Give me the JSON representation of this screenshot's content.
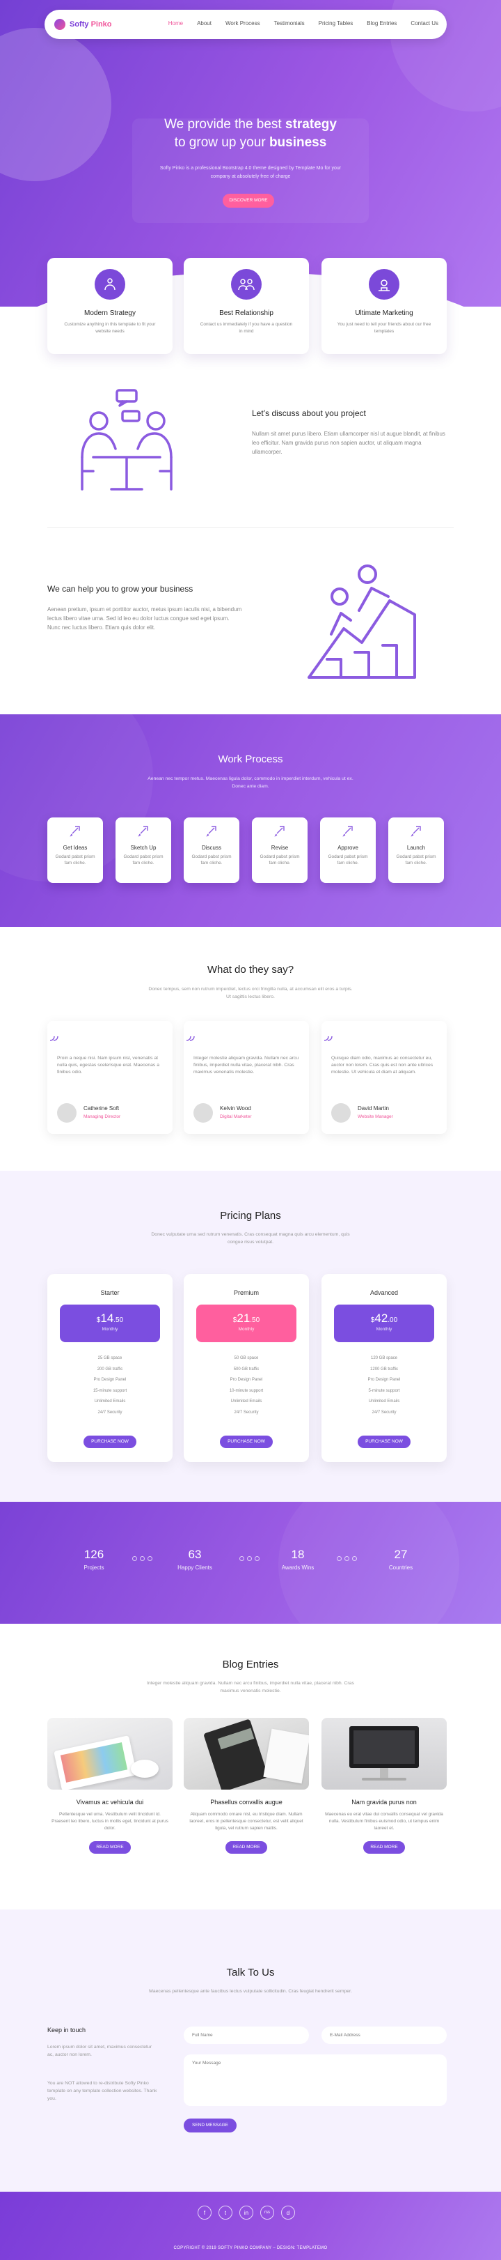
{
  "brand": {
    "name_main": "Softy",
    "name_accent": "Pinko"
  },
  "nav": {
    "items": [
      "Home",
      "About",
      "Work Process",
      "Testimonials",
      "Pricing Tables",
      "Blog Entries",
      "Contact Us"
    ]
  },
  "hero": {
    "title_pre": "We provide the best ",
    "title_b1": "strategy",
    "title_mid": "to grow up your ",
    "title_b2": "business",
    "subtitle": "Softy Pinko is a professional Bootstrap 4.0 theme designed by Template Mo for your company at absolutely free of charge",
    "cta": "DISCOVER MORE"
  },
  "features": [
    {
      "title": "Modern Strategy",
      "text": "Customize anything in this template to fit your website needs",
      "icon": "strategy-icon"
    },
    {
      "title": "Best Relationship",
      "text": "Contact us immediately if you have a question in mind",
      "icon": "relationship-icon"
    },
    {
      "title": "Ultimate Marketing",
      "text": "You just need to tell your friends about our free templates",
      "icon": "marketing-icon"
    }
  ],
  "about1": {
    "title": "Let’s discuss about you project",
    "text": "Nullam sit amet purus libero. Etiam ullamcorper nisl ut augue blandit, at finibus leo efficitur. Nam gravida purus non sapien auctor, ut aliquam magna ullamcorper."
  },
  "about2": {
    "title": "We can help you to grow your business",
    "text": "Aenean pretium, ipsum et porttitor auctor, metus ipsum iaculis nisi, a bibendum lectus libero vitae urna. Sed id leo eu dolor luctus congue sed eget ipsum. Nunc nec luctus libero. Etiam quis dolor elit."
  },
  "work": {
    "title": "Work Process",
    "subtitle": "Aenean nec tempor metus. Maecenas ligula dolor, commodo in imperdiet interdum, vehicula ut ex. Donec ante diam.",
    "steps": [
      {
        "title": "Get Ideas",
        "text": "Godard pabst prism fam cliche."
      },
      {
        "title": "Sketch Up",
        "text": "Godard pabst prism fam cliche."
      },
      {
        "title": "Discuss",
        "text": "Godard pabst prism fam cliche."
      },
      {
        "title": "Revise",
        "text": "Godard pabst prism fam cliche."
      },
      {
        "title": "Approve",
        "text": "Godard pabst prism fam cliche."
      },
      {
        "title": "Launch",
        "text": "Godard pabst prism fam cliche."
      }
    ]
  },
  "testimonials": {
    "title": "What do they say?",
    "subtitle": "Donec tempus, sem non rutrum imperdiet, lectus orci fringilla nulla, at accumsan elit eros a turpis. Ut sagittis lectus libero.",
    "items": [
      {
        "text": "Proin a neque nisi. Nam ipsum nisl, venenatis at nulla quis, egestas scelerisque erat. Maecenas a finibus odio.",
        "name": "Catherine Soft",
        "role": "Managing Director"
      },
      {
        "text": "Integer molestie aliquam gravida. Nullam nec arcu finibus, imperdiet nulla vitae, placerat nibh. Cras maximus venenatis molestie.",
        "name": "Kelvin Wood",
        "role": "Digital Marketer"
      },
      {
        "text": "Quisque diam odio, maximus ac consectetur eu, auctor non lorem. Cras quis est non ante ultrices molestie. Ut vehicula et diam at aliquam.",
        "name": "David Martin",
        "role": "Website Manager"
      }
    ]
  },
  "pricing": {
    "title": "Pricing Plans",
    "subtitle": "Donec vulputate urna sed rutrum venenatis. Cras consequat magna quis arcu elementum, quis congue risus volutpat.",
    "plans": [
      {
        "name": "Starter",
        "currency": "$",
        "price": "14",
        "cents": ".50",
        "period": "Monthly",
        "color": "#7b4ee0",
        "features": [
          "25 GB space",
          "200 GB traffic",
          "Pro Design Panel",
          "15-minute support",
          "Unlimited Emails",
          "24/7 Security"
        ],
        "button": "PURCHASE NOW"
      },
      {
        "name": "Premium",
        "currency": "$",
        "price": "21",
        "cents": ".50",
        "period": "Monthly",
        "color": "#ff5f9e",
        "features": [
          "50 GB space",
          "500 GB traffic",
          "Pro Design Panel",
          "10-minute support",
          "Unlimited Emails",
          "24/7 Security"
        ],
        "button": "PURCHASE NOW"
      },
      {
        "name": "Advanced",
        "currency": "$",
        "price": "42",
        "cents": ".00",
        "period": "Monthly",
        "color": "#7b4ee0",
        "features": [
          "120 GB space",
          "1200 GB traffic",
          "Pro Design Panel",
          "5-minute support",
          "Unlimited Emails",
          "24/7 Security"
        ],
        "button": "PURCHASE NOW"
      }
    ]
  },
  "stats": [
    {
      "value": "126",
      "label": "Projects"
    },
    {
      "value": "63",
      "label": "Happy Clients"
    },
    {
      "value": "18",
      "label": "Awards Wins"
    },
    {
      "value": "27",
      "label": "Countries"
    }
  ],
  "blog": {
    "title": "Blog Entries",
    "subtitle": "Integer molestie aliquam gravida. Nullam nec arcu finibus, imperdiet nulla vitae, placerat nibh. Cras maximus venenatis molestie.",
    "posts": [
      {
        "title": "Vivamus ac vehicula dui",
        "text": "Pellentesque vel urna. Vestibulum velit tincidunt id. Praesent leo libero, luctus in mollis eget, tincidunt at purus dolor.",
        "button": "READ MORE"
      },
      {
        "title": "Phasellus convallis augue",
        "text": "Aliquam commodo ornare nisl, eu tristique diam. Nullam laoreet, eros in pellentesque consectetur, est velit aliquet ligula, vel rutrum sapien mattis.",
        "button": "READ MORE"
      },
      {
        "title": "Nam gravida purus non",
        "text": "Maecenas eu erat vitae dui convallis consequat vel gravida nulla. Vestibulum finibus euismod odio, ut tempus enim laoreet et.",
        "button": "READ MORE"
      }
    ]
  },
  "contact": {
    "title": "Talk To Us",
    "subtitle": "Maecenas pellentesque ante faucibus lectus vulputate sollicitudin. Cras feugiat hendrerit semper.",
    "keep_title": "Keep in touch",
    "keep_text1": "Lorem ipsum dolor sit amet, maximus consectetur ac, auctor non lorem.",
    "keep_text2": "You are NOT allowed to re-distribute Softy Pinko template on any template collection websites. Thank you.",
    "name_placeholder": "Full Name",
    "email_placeholder": "E-Mail Address",
    "message_placeholder": "Your Message",
    "send": "SEND MESSAGE"
  },
  "footer": {
    "social": [
      "f",
      "t",
      "in",
      "rss",
      "d"
    ],
    "copyright": "COPYRIGHT © 2019 SOFTY PINKO COMPANY – DESIGN: TEMPLATEMO"
  }
}
